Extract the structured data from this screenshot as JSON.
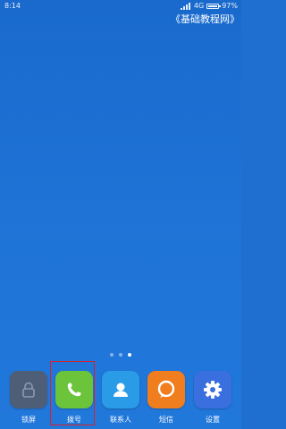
{
  "status_bar": {
    "time": "8:14",
    "network": "4G",
    "battery_percent": "97%",
    "battery_level": 0.97
  },
  "watermark": "《基础教程网》",
  "page_indicator": {
    "pages": 3,
    "active_index": 2
  },
  "dock": {
    "apps": [
      {
        "label": "锁屏",
        "icon": "lock-icon",
        "color": "#4f5e77"
      },
      {
        "label": "拨号",
        "icon": "phone-icon",
        "color": "#6cc43b"
      },
      {
        "label": "联系人",
        "icon": "contact-icon",
        "color": "#2a9be6"
      },
      {
        "label": "短信",
        "icon": "message-icon",
        "color": "#f07d1e"
      },
      {
        "label": "设置",
        "icon": "gear-icon",
        "color": "#3a6fe0"
      }
    ]
  },
  "colors": {
    "wallpaper": "#1f73d6",
    "highlight": "#d4232b"
  }
}
